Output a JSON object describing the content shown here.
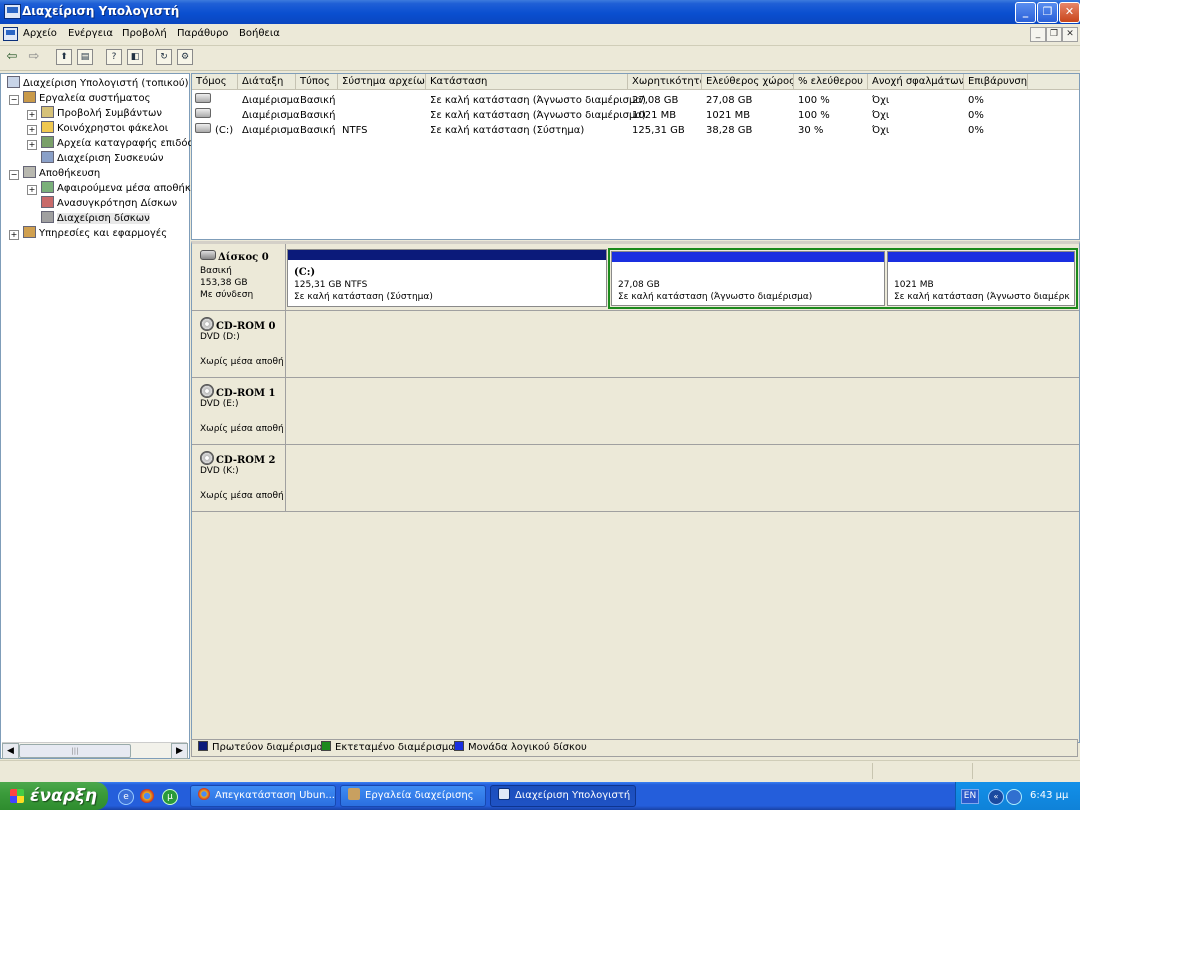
{
  "window": {
    "title": "Διαχείριση Υπολογιστή"
  },
  "menu": [
    "Αρχείο",
    "Ενέργεια",
    "Προβολή",
    "Παράθυρο",
    "Βοήθεια"
  ],
  "tree": [
    {
      "label": "Διαχείριση Υπολογιστή (τοπικού)",
      "level": 0
    },
    {
      "label": "Εργαλεία συστήματος",
      "level": 1,
      "expander": "−"
    },
    {
      "label": "Προβολή Συμβάντων",
      "level": 2,
      "expander": "+"
    },
    {
      "label": "Κοινόχρηστοι φάκελοι",
      "level": 2,
      "expander": "+"
    },
    {
      "label": "Αρχεία καταγραφής επιδόσε",
      "level": 2,
      "expander": "+"
    },
    {
      "label": "Διαχείριση Συσκευών",
      "level": 2
    },
    {
      "label": "Αποθήκευση",
      "level": 1,
      "expander": "−"
    },
    {
      "label": "Αφαιρούμενα μέσα αποθήκε",
      "level": 2,
      "expander": "+"
    },
    {
      "label": "Ανασυγκρότηση Δίσκων",
      "level": 2
    },
    {
      "label": "Διαχείριση δίσκων",
      "level": 2,
      "selected": true
    },
    {
      "label": "Υπηρεσίες και εφαρμογές",
      "level": 1,
      "expander": "+"
    }
  ],
  "volumes": {
    "columns": [
      "Τόμος",
      "Διάταξη",
      "Τύπος",
      "Σύστημα αρχείων",
      "Κατάσταση",
      "Χωρητικότητα",
      "Ελεύθερος χώρος",
      "% ελεύθερου",
      "Ανοχή σφαλμάτων",
      "Επιβάρυνση"
    ],
    "rows": [
      [
        "",
        "Διαμέρισμα",
        "Βασική",
        "",
        "Σε καλή κατάσταση (Άγνωστο διαμέρισμα)",
        "27,08 GB",
        "27,08 GB",
        "100 %",
        "Όχι",
        "0%"
      ],
      [
        "",
        "Διαμέρισμα",
        "Βασική",
        "",
        "Σε καλή κατάσταση (Άγνωστο διαμέρισμα)",
        "1021 MB",
        "1021 MB",
        "100 %",
        "Όχι",
        "0%"
      ],
      [
        "(C:)",
        "Διαμέρισμα",
        "Βασική",
        "NTFS",
        "Σε καλή κατάσταση (Σύστημα)",
        "125,31 GB",
        "38,28 GB",
        "30 %",
        "Όχι",
        "0%"
      ]
    ]
  },
  "disks": [
    {
      "name": "Δίσκος 0",
      "type": "Βασική",
      "size": "153,38 GB",
      "status": "Με σύνδεση",
      "partitions": [
        {
          "title": "(C:)",
          "size": "125,31 GB NTFS",
          "status": "Σε καλή κατάσταση (Σύστημα)",
          "color": "#0b1a7a"
        },
        {
          "title": "",
          "size": "27,08 GB",
          "status": "Σε καλή κατάσταση (Άγνωστο διαμέρισμα)",
          "color": "#1a2fe0"
        },
        {
          "title": "",
          "size": "1021 MB",
          "status": "Σε καλή κατάσταση (Άγνωστο διαμέρκ",
          "color": "#1a2fe0"
        }
      ]
    },
    {
      "name": "CD-ROM 0",
      "type": "DVD (D:)",
      "status": "Χωρίς μέσα αποθή"
    },
    {
      "name": "CD-ROM 1",
      "type": "DVD (E:)",
      "status": "Χωρίς μέσα αποθή"
    },
    {
      "name": "CD-ROM 2",
      "type": "DVD (K:)",
      "status": "Χωρίς μέσα αποθή"
    }
  ],
  "legend": [
    {
      "label": "Πρωτεύον διαμέρισμα",
      "color": "#0b1a7a"
    },
    {
      "label": "Εκτεταμένο διαμέρισμα",
      "color": "#1c8a1c"
    },
    {
      "label": "Μονάδα λογικού δίσκου",
      "color": "#1a2fe0"
    }
  ],
  "taskbar": {
    "start_label": "έναρξη",
    "buttons": [
      "Απεγκατάσταση Ubun...",
      "Εργαλεία διαχείρισης",
      "Διαχείριση Υπολογιστή"
    ],
    "lang": "EN",
    "clock": "6:43 μμ"
  },
  "colors": {
    "titlebar": "#0a4fd0",
    "primary_partition": "#0b1a7a",
    "extended_partition": "#1c8a1c",
    "logical_drive": "#1a2fe0",
    "taskbar": "#245edb",
    "start_button": "#3b9b3b"
  }
}
